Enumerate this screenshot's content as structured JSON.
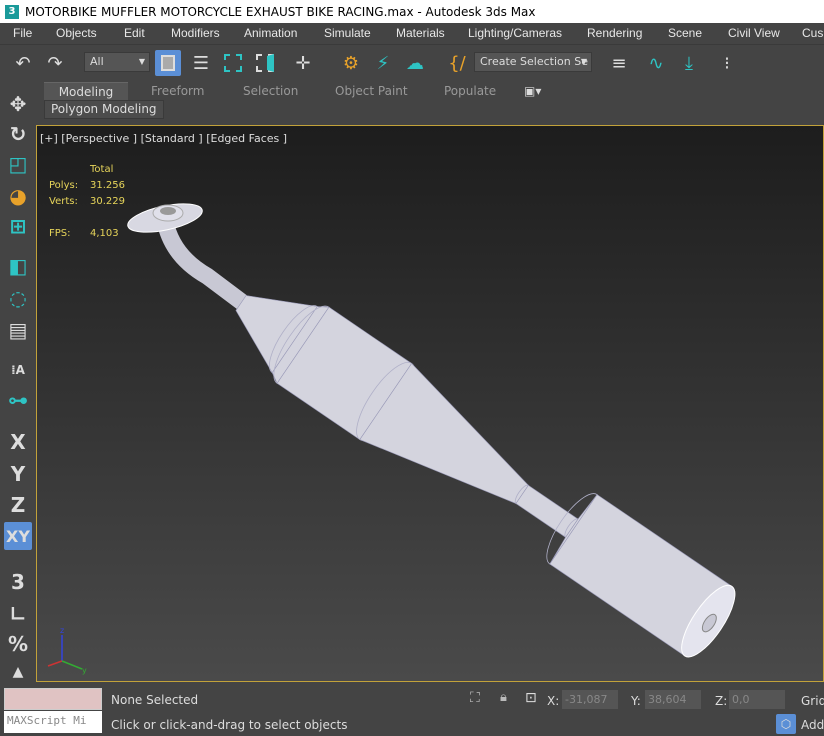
{
  "window": {
    "title": "MOTORBIKE MUFFLER MOTORCYCLE EXHAUST BIKE RACING.max - Autodesk 3ds Max",
    "logo": "3"
  },
  "menu": [
    "File",
    "Objects",
    "Edit",
    "Modifiers",
    "Animation",
    "Simulate",
    "Materials",
    "Lighting/Cameras",
    "Rendering",
    "Scene",
    "Civil View",
    "Cus"
  ],
  "toolbar": {
    "filter": "All",
    "selection_set": "Create Selection Se"
  },
  "ribbon": {
    "tabs": [
      "Modeling",
      "Freeform",
      "Selection",
      "Object Paint",
      "Populate"
    ],
    "active_tab": "Modeling",
    "panel": "Polygon Modeling"
  },
  "left_tools": {
    "x": "X",
    "y": "Y",
    "z": "Z",
    "xy": "XY",
    "snap3": "3",
    "percent": "%"
  },
  "viewport": {
    "label": "[+] [Perspective ] [Standard ] [Edged Faces ]",
    "stats": {
      "header": "Total",
      "polys_label": "Polys:",
      "polys": "31.256",
      "verts_label": "Verts:",
      "verts": "30.229",
      "fps_label": "FPS:",
      "fps": "4,103"
    },
    "axis": {
      "z": "z",
      "y": "y",
      "x": "x"
    }
  },
  "status": {
    "selection": "None Selected",
    "prompt": "Click or click-and-drag to select objects",
    "maxscript": "MAXScript Mi",
    "x_label": "X:",
    "x": "-31,087",
    "y_label": "Y:",
    "y": "38,604",
    "z_label": "Z:",
    "z": "0,0",
    "grid": "Grid",
    "add": "Add"
  },
  "colors": {
    "accent": "#5b8fd6",
    "viewport_border": "#c2a23a",
    "stats_text": "#e6d45a",
    "teal_icon": "#2ec4c4"
  }
}
